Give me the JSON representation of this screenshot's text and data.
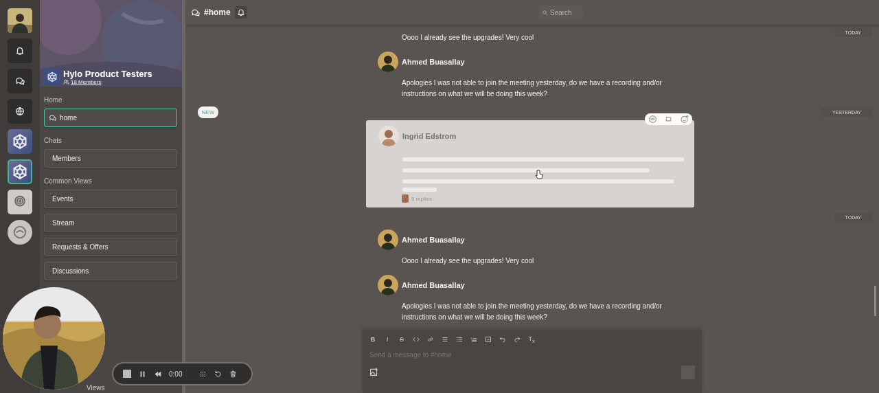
{
  "rail": {
    "items": [
      {
        "kind": "avatar",
        "selected": false
      },
      {
        "kind": "bell",
        "selected": false
      },
      {
        "kind": "chats",
        "selected": false
      },
      {
        "kind": "globe",
        "selected": false
      },
      {
        "kind": "group",
        "selected": false
      },
      {
        "kind": "group",
        "selected": true
      },
      {
        "kind": "org",
        "selected": false
      },
      {
        "kind": "seal",
        "selected": false
      }
    ]
  },
  "group": {
    "name": "Hylo Product Testers",
    "members": "18 Members"
  },
  "sidebar": {
    "sections": [
      {
        "title": "Home",
        "items": [
          {
            "label": "home",
            "kind": "channel",
            "selected": true
          }
        ]
      },
      {
        "title": "Chats",
        "items": [
          {
            "label": "Members",
            "kind": "view",
            "selected": false
          }
        ]
      },
      {
        "title": "Common Views",
        "items": [
          {
            "label": "Events",
            "kind": "view",
            "selected": false
          },
          {
            "label": "Stream",
            "kind": "view",
            "selected": false
          },
          {
            "label": "Requests & Offers",
            "kind": "view",
            "selected": false
          },
          {
            "label": "Discussions",
            "kind": "view",
            "selected": false
          }
        ]
      }
    ],
    "footer_fragment": "Views"
  },
  "header": {
    "channel": "#home",
    "search_placeholder": "Search"
  },
  "feed": [
    {
      "kind": "continuation",
      "text": "Oooo I already see the upgrades! Very cool",
      "date": "TODAY"
    },
    {
      "kind": "message",
      "author": "Ahmed Buasallay",
      "text": "Apologies I was not able to join the meeting yesterday, do we have a recording and/or instructions on what we will be doing this week?"
    },
    {
      "kind": "divider",
      "date": "YESTERDAY",
      "badge": "NEW"
    },
    {
      "kind": "highlighted",
      "author": "Ingrid Edstrom",
      "replies": "5 replies"
    },
    {
      "kind": "divider",
      "date": "TODAY"
    },
    {
      "kind": "message",
      "author": "Ahmed Buasallay",
      "text": "Oooo I already see the upgrades! Very cool"
    },
    {
      "kind": "message",
      "author": "Ahmed Buasallay",
      "text": "Apologies I was not able to join the meeting yesterday, do we have a recording and/or instructions on what we will be doing this week?"
    }
  ],
  "composer": {
    "format_letters": [
      "B",
      "I",
      "S"
    ],
    "clear_format": "T$_{x}$",
    "placeholder": "Send a message to #home"
  },
  "recorder": {
    "time": "0:00"
  }
}
